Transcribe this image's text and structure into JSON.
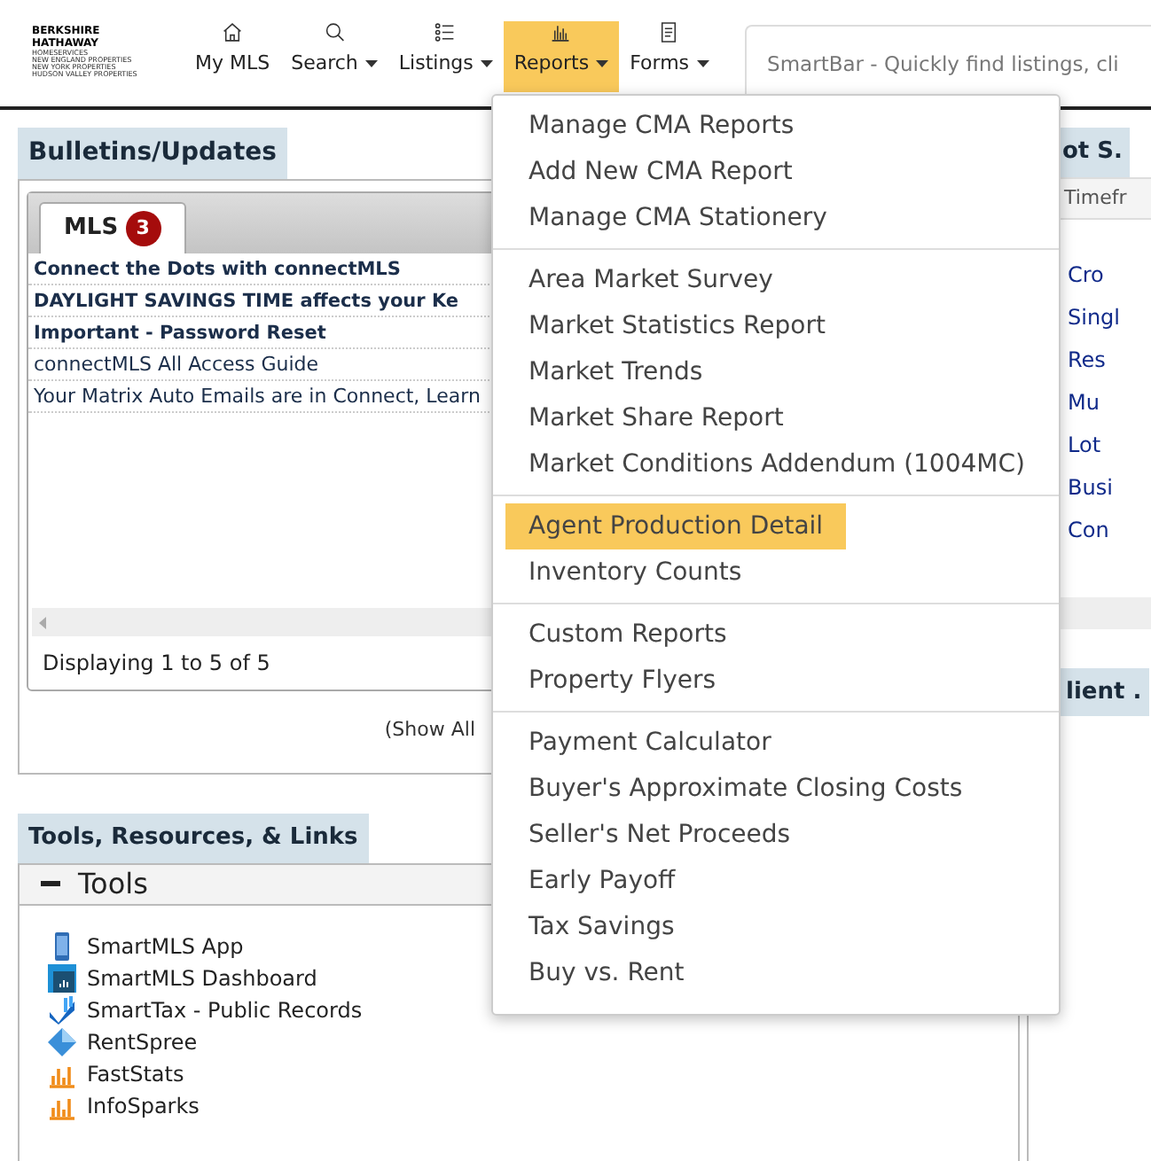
{
  "logo": {
    "lines": [
      "BERKSHIRE",
      "HATHAWAY",
      "HOMESERVICES",
      "NEW ENGLAND PROPERTIES",
      "NEW YORK PROPERTIES",
      "HUDSON VALLEY PROPERTIES"
    ]
  },
  "nav": [
    {
      "label": "My MLS",
      "kind": "home",
      "dropdown": false,
      "selected": false
    },
    {
      "label": "Search",
      "kind": "search",
      "dropdown": true,
      "selected": false
    },
    {
      "label": "Listings",
      "kind": "list",
      "dropdown": true,
      "selected": false
    },
    {
      "label": "Reports",
      "kind": "chart",
      "dropdown": true,
      "selected": true
    },
    {
      "label": "Forms",
      "kind": "form",
      "dropdown": true,
      "selected": false
    }
  ],
  "smartbar": {
    "placeholder": "SmartBar - Quickly find listings, cli"
  },
  "bulletins": {
    "title": "Bulletins/Updates",
    "tabs": [
      {
        "label": "MLS",
        "badge": "3",
        "selected": true
      }
    ],
    "items": [
      {
        "text": "Connect the Dots with connectMLS",
        "bold": true
      },
      {
        "text": "DAYLIGHT SAVINGS TIME affects your Ke",
        "bold": true
      },
      {
        "text": "Important - Password Reset",
        "bold": true
      },
      {
        "text": "connectMLS All Access Guide",
        "bold": false
      },
      {
        "text": "Your Matrix Auto Emails are in Connect, Learn",
        "bold": false
      }
    ],
    "footer": "Displaying 1 to 5 of 5",
    "show_all": "(Show All"
  },
  "tools": {
    "title": "Tools, Resources, & Links",
    "section": {
      "label": "Tools",
      "expanded": true,
      "items": [
        {
          "label": "SmartMLS App",
          "kind": "phone"
        },
        {
          "label": "SmartMLS Dashboard",
          "kind": "dashboard"
        },
        {
          "label": "SmartTax - Public Records",
          "kind": "tax"
        },
        {
          "label": "RentSpree",
          "kind": "diamond"
        },
        {
          "label": "FastStats",
          "kind": "bars"
        },
        {
          "label": "InfoSparks",
          "kind": "bars"
        }
      ]
    }
  },
  "side_panel": {
    "title": "ot S.",
    "filter": "Timefr",
    "links": [
      "Cro",
      "Singl",
      "Res",
      "Mu",
      "Lot",
      "Busi",
      "Con"
    ],
    "second_title": "lient ."
  },
  "menu": {
    "groups": [
      [
        {
          "label": "Manage CMA Reports",
          "selected": false
        },
        {
          "label": "Add New CMA Report",
          "selected": false
        },
        {
          "label": "Manage CMA Stationery",
          "selected": false
        }
      ],
      [
        {
          "label": "Area Market Survey",
          "selected": false
        },
        {
          "label": "Market Statistics Report",
          "selected": false
        },
        {
          "label": "Market Trends",
          "selected": false
        },
        {
          "label": "Market Share Report",
          "selected": false
        },
        {
          "label": "Market Conditions Addendum (1004MC)",
          "selected": false
        }
      ],
      [
        {
          "label": "Agent Production Detail",
          "selected": true
        },
        {
          "label": "Inventory Counts",
          "selected": false
        }
      ],
      [
        {
          "label": "Custom Reports",
          "selected": false
        },
        {
          "label": "Property Flyers",
          "selected": false
        }
      ],
      [
        {
          "label": "Payment Calculator",
          "selected": false
        },
        {
          "label": "Buyer's Approximate Closing Costs",
          "selected": false
        },
        {
          "label": "Seller's Net Proceeds",
          "selected": false
        },
        {
          "label": "Early Payoff",
          "selected": false
        },
        {
          "label": "Tax Savings",
          "selected": false
        },
        {
          "label": "Buy vs. Rent",
          "selected": false
        }
      ]
    ]
  }
}
